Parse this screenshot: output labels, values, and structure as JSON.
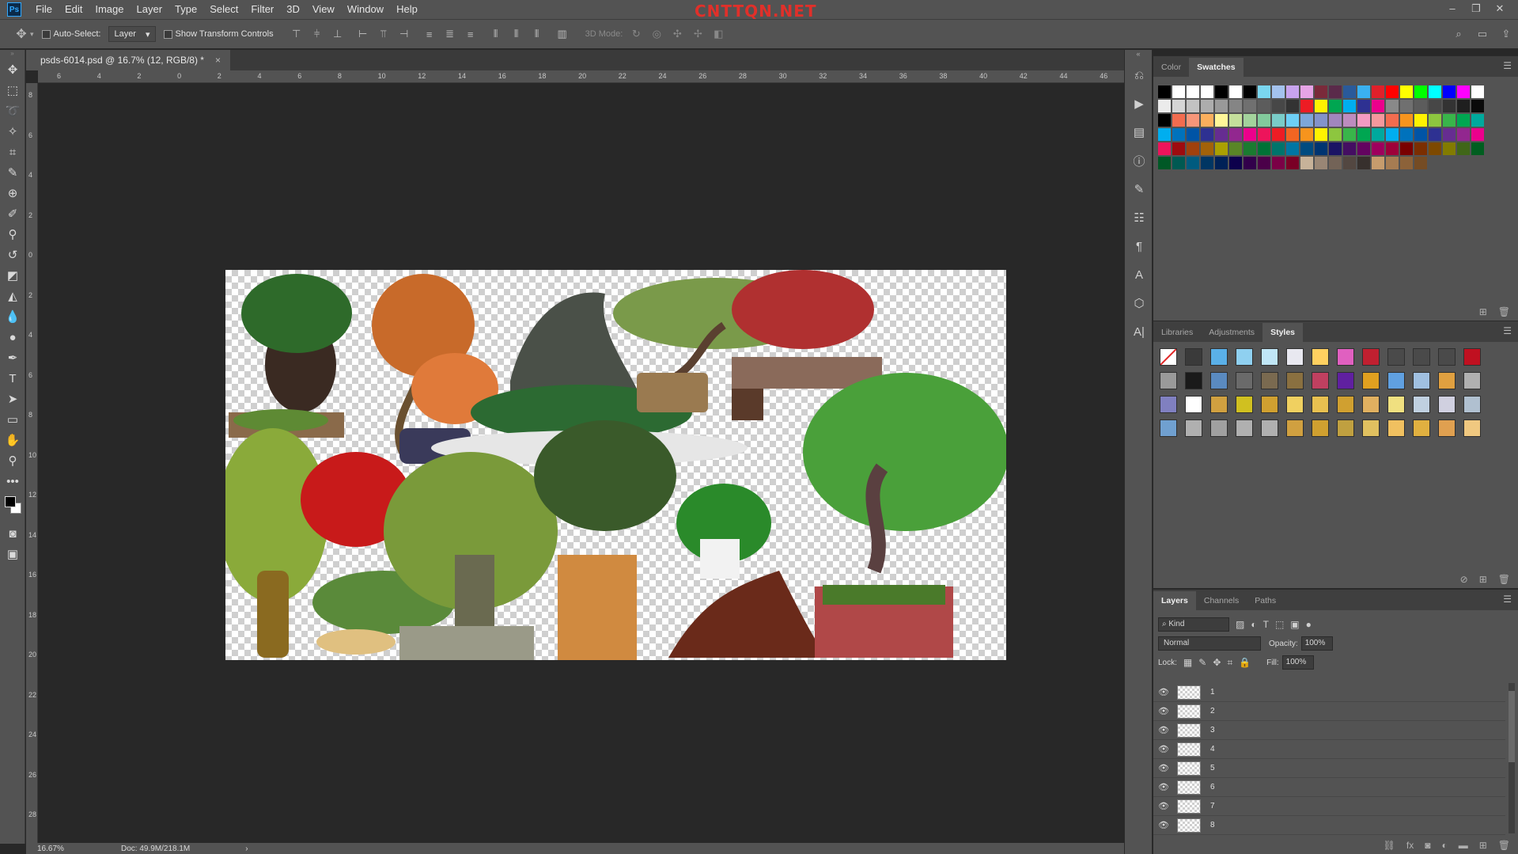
{
  "menubar": {
    "logo": "Ps",
    "items": [
      "File",
      "Edit",
      "Image",
      "Layer",
      "Type",
      "Select",
      "Filter",
      "3D",
      "View",
      "Window",
      "Help"
    ],
    "watermark": "CNTTQN.NET",
    "window_controls": [
      "–",
      "❐",
      "✕"
    ]
  },
  "options": {
    "auto_select_label": "Auto-Select:",
    "auto_select_target": "Layer",
    "show_transform_label": "Show Transform Controls",
    "mode_3d_label": "3D Mode:"
  },
  "document": {
    "tab_title": "psds-6014.psd @ 16.7% (12, RGB/8) *",
    "tab_close": "×",
    "ruler_h_labels": [
      "6",
      "4",
      "2",
      "0",
      "2",
      "4",
      "6",
      "8",
      "10",
      "12",
      "14",
      "16",
      "18",
      "20",
      "22",
      "24",
      "26",
      "28",
      "30",
      "32",
      "34",
      "36",
      "38",
      "40",
      "42",
      "44",
      "46"
    ],
    "ruler_v_labels": [
      "8",
      "6",
      "4",
      "2",
      "0",
      "2",
      "4",
      "6",
      "8",
      "10",
      "12",
      "14",
      "16",
      "18",
      "20",
      "22",
      "24",
      "26",
      "28"
    ]
  },
  "status": {
    "zoom": "16.67%",
    "doc_size": "Doc: 49.9M/218.1M",
    "arrow": "›"
  },
  "panels": {
    "color_tabs": [
      "Color",
      "Swatches"
    ],
    "color_active": "Swatches",
    "styles_tabs": [
      "Libraries",
      "Adjustments",
      "Styles"
    ],
    "styles_active": "Styles",
    "layers_tabs": [
      "Layers",
      "Channels",
      "Paths"
    ],
    "layers_active": "Layers"
  },
  "swatches": [
    "#000000",
    "#ffffff",
    "#ffffff",
    "#ffffff",
    "#000000",
    "#ffffff",
    "#000000",
    "#7ad6ef",
    "#a4c3ee",
    "#c8a4ee",
    "#e6a4e6",
    "#7a2a3a",
    "#5a2a4a",
    "#2a5a9a",
    "#3ab0f0",
    "#e0202a",
    "#ff0000",
    "#ffff00",
    "#00ff00",
    "#00ffff",
    "#0000ff",
    "#ff00ff",
    "#ffffff",
    "#ebebeb",
    "#d6d6d6",
    "#c2c2c2",
    "#adadad",
    "#999999",
    "#858585",
    "#707070",
    "#5c5c5c",
    "#474747",
    "#333333",
    "#ed1c24",
    "#fff200",
    "#00a651",
    "#00aeef",
    "#2e3192",
    "#ec008c",
    "#898989",
    "#707070",
    "#5c5c5c",
    "#474747",
    "#333333",
    "#1f1f1f",
    "#0a0a0a",
    "#000000",
    "#f26c4f",
    "#f69679",
    "#fbaf5d",
    "#fff799",
    "#c4df9b",
    "#a3d39c",
    "#82ca9c",
    "#7accc8",
    "#6dcff6",
    "#7da7d9",
    "#8393ca",
    "#a186be",
    "#bd8cbf",
    "#f49ac2",
    "#f5989d",
    "#f26c4f",
    "#f7941d",
    "#fff200",
    "#8dc63f",
    "#39b54a",
    "#00a651",
    "#00a99d",
    "#00aeef",
    "#0072bc",
    "#0054a6",
    "#2e3192",
    "#662d91",
    "#92278f",
    "#ec008c",
    "#ed145b",
    "#ed1c24",
    "#f26522",
    "#f7941d",
    "#fff200",
    "#8dc63f",
    "#39b54a",
    "#00a651",
    "#00a99d",
    "#00aeef",
    "#0072bc",
    "#0054a6",
    "#2e3192",
    "#662d91",
    "#92278f",
    "#ec008c",
    "#ed145b",
    "#9e0b0f",
    "#a0410d",
    "#a36209",
    "#aba000",
    "#598527",
    "#1a7b30",
    "#007236",
    "#00746b",
    "#0076a3",
    "#004b80",
    "#003471",
    "#1b1464",
    "#440e62",
    "#630460",
    "#9e005d",
    "#9e0039",
    "#790000",
    "#7b2e00",
    "#7d4900",
    "#827b00",
    "#406618",
    "#005e20",
    "#005826",
    "#005952",
    "#005b7f",
    "#003663",
    "#002157",
    "#0d004c",
    "#32004b",
    "#4b0049",
    "#7b0046",
    "#7a0026",
    "#c7b299",
    "#998675",
    "#736357",
    "#534741",
    "#37302d",
    "#c69c6d",
    "#a67c52",
    "#8c6239",
    "#754c24"
  ],
  "styles": [
    "#ffffff",
    "#3a3a3a",
    "#5ab0e8",
    "#8fd0f0",
    "#c0e6f6",
    "#e8e8f0",
    "#ffd060",
    "#e060c0",
    "#c02030",
    "#4a4a4a",
    "#4a4a4a",
    "#4a4a4a",
    "#c01020",
    "#9a9a9a",
    "#1a1a1a",
    "#5a8ac0",
    "#6a6a6a",
    "#7a6a50",
    "#8a7040",
    "#c04060",
    "#6020a0",
    "#e0a020",
    "#60a0e0",
    "#a0c0e0",
    "#e0a040",
    "#b0b0b0",
    "#8080c0",
    "#ffffff",
    "#d0a040",
    "#d0c020",
    "#d0a030",
    "#f0d060",
    "#e8c050",
    "#d0a030",
    "#e0b060",
    "#f0e080",
    "#c0d0e0",
    "#d0d0e0",
    "#b0c0d0",
    "#70a0d0",
    "#b0b0b0",
    "#a0a0a0",
    "#b0b0b0",
    "#b0b0b0",
    "#d0a040",
    "#d0a030",
    "#c0a040",
    "#e0c060",
    "#f0c060",
    "#e0b040",
    "#e0a050",
    "#f0c880"
  ],
  "layers_panel": {
    "kind_label": "Kind",
    "blend_mode": "Normal",
    "opacity_label": "Opacity:",
    "opacity_value": "100%",
    "lock_label": "Lock:",
    "fill_label": "Fill:",
    "fill_value": "100%",
    "layers": [
      "1",
      "2",
      "3",
      "4",
      "5",
      "6",
      "7",
      "8"
    ]
  }
}
